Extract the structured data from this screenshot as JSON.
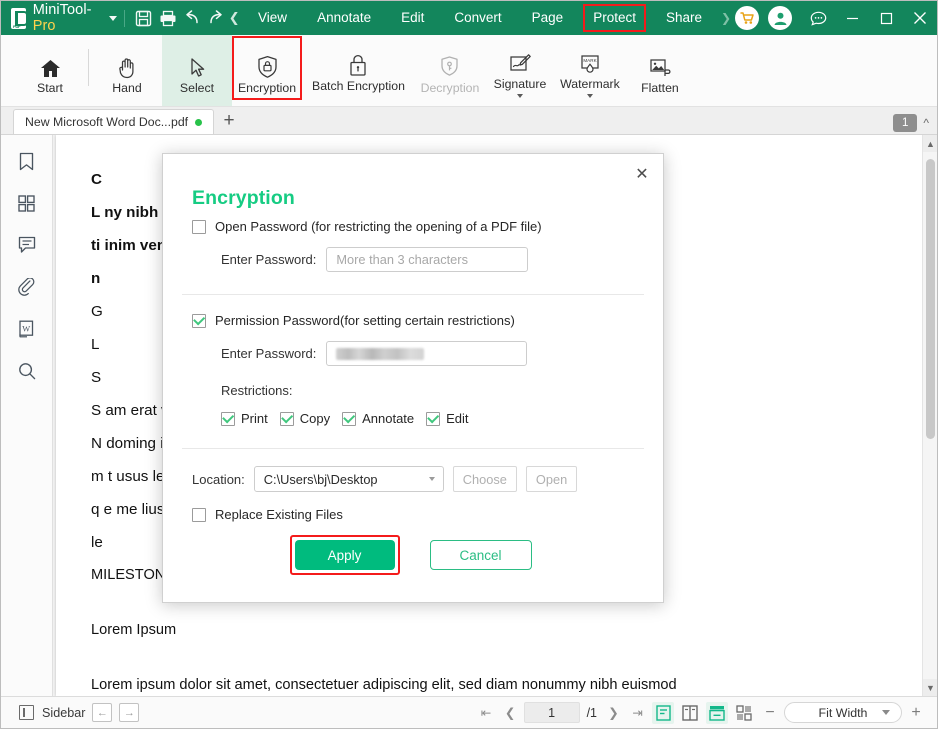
{
  "titlebar": {
    "brand_name_main": "MiniTool-",
    "brand_name_accent": "Pro",
    "logo_icon": "pdf-logo-icon",
    "save_icon": "save-icon",
    "print_icon": "print-icon",
    "undo_icon": "undo-icon",
    "redo_icon": "redo-icon",
    "collapse_icon": "chevron-left-icon",
    "menu": [
      {
        "label": "View",
        "active": false,
        "highlighted": false
      },
      {
        "label": "Annotate",
        "active": false,
        "highlighted": false
      },
      {
        "label": "Edit",
        "active": false,
        "highlighted": false
      },
      {
        "label": "Convert",
        "active": false,
        "highlighted": false
      },
      {
        "label": "Page",
        "active": false,
        "highlighted": false
      },
      {
        "label": "Protect",
        "active": true,
        "highlighted": true
      },
      {
        "label": "Share",
        "active": false,
        "highlighted": false
      }
    ],
    "menu_more_icon": "chevron-right-icon",
    "cart_icon": "shopping-cart-icon",
    "account_icon": "user-account-icon",
    "feedback_icon": "chat-bubble-icon",
    "minimize_icon": "minimize-icon",
    "maximize_icon": "maximize-icon",
    "close_icon": "close-icon",
    "accent_color": "#13865c",
    "highlight_color": "#f41b1b"
  },
  "ribbon": {
    "items": [
      {
        "label": "Start",
        "icon": "home-icon",
        "state": "normal",
        "caret": false,
        "highlighted": false
      },
      {
        "label": "Hand",
        "icon": "hand-icon",
        "state": "normal",
        "caret": false,
        "highlighted": false
      },
      {
        "label": "Select",
        "icon": "cursor-arrow-icon",
        "state": "selected",
        "caret": false,
        "highlighted": false
      },
      {
        "label": "Encryption",
        "icon": "shield-lock-icon",
        "state": "normal",
        "caret": false,
        "highlighted": true
      },
      {
        "label": "Batch Encryption",
        "icon": "padlock-icon",
        "state": "normal",
        "caret": false,
        "highlighted": false
      },
      {
        "label": "Decryption",
        "icon": "shield-key-icon",
        "state": "disabled",
        "caret": false,
        "highlighted": false
      },
      {
        "label": "Signature",
        "icon": "signature-pen-icon",
        "state": "normal",
        "caret": true,
        "highlighted": false
      },
      {
        "label": "Watermark",
        "icon": "watermark-icon",
        "state": "normal",
        "caret": true,
        "highlighted": false
      },
      {
        "label": "Flatten",
        "icon": "flatten-image-icon",
        "state": "normal",
        "caret": false,
        "highlighted": false
      }
    ]
  },
  "tabstrip": {
    "document_tab_label": "New Microsoft Word Doc...pdf",
    "modified_dot": "unsaved-indicator",
    "new_tab_icon": "plus-icon",
    "page_badge": "1",
    "scroll_up_icon": "chevron-up-icon"
  },
  "sidebar": {
    "items": [
      {
        "icon": "bookmark-icon",
        "name": "bookmarks"
      },
      {
        "icon": "thumbnails-icon",
        "name": "thumbnails"
      },
      {
        "icon": "comment-icon",
        "name": "comments"
      },
      {
        "icon": "attachment-icon",
        "name": "attachments"
      },
      {
        "icon": "word-doc-icon",
        "name": "word-export"
      },
      {
        "icon": "search-icon",
        "name": "search"
      }
    ]
  },
  "document": {
    "lines": [
      {
        "text": "C",
        "bold": true,
        "kind": "heading"
      },
      {
        "text": "L                                                                                                 ny nibh euismod",
        "bold": true,
        "kind": "body"
      },
      {
        "text": "ti                                                                                                 inim veniam, quis",
        "bold": true,
        "kind": "body"
      },
      {
        "text": "n",
        "bold": true,
        "kind": "body"
      },
      {
        "text": "G",
        "bold": false,
        "kind": "body"
      },
      {
        "text": "L",
        "bold": false,
        "kind": "body"
      },
      {
        "text": "S",
        "bold": false,
        "kind": "body"
      },
      {
        "text": "S                                                                                                 am erat volutpat.",
        "bold": false,
        "kind": "body"
      },
      {
        "text": "N                                                                                                 doming id quod",
        "bold": false,
        "kind": "body"
      },
      {
        "text": "m                                                                                                 t usus legentis in iis",
        "bold": false,
        "kind": "body"
      },
      {
        "text": "q                                                                                                 e me lius quod ii",
        "bold": false,
        "kind": "body"
      },
      {
        "text": "le",
        "bold": false,
        "kind": "body"
      }
    ],
    "visible_tail": [
      "MILESTONES",
      "Lorem Ipsum",
      "Lorem ipsum dolor sit amet, consectetuer adipiscing elit, sed diam nonummy nibh euismod"
    ]
  },
  "dialog": {
    "title": "Encryption",
    "title_color": "#16cc83",
    "close_icon": "close-icon",
    "open_password": {
      "checkbox_label": "Open Password (for restricting the opening of a PDF file)",
      "checked": false,
      "field_label": "Enter Password:",
      "placeholder": "More than 3 characters",
      "value": ""
    },
    "permission_password": {
      "checkbox_label": "Permission Password(for setting certain restrictions)",
      "checked": true,
      "field_label": "Enter Password:",
      "value": "••••••••",
      "masked": true,
      "restrictions_label": "Restrictions:",
      "restrictions": [
        {
          "label": "Print",
          "checked": true
        },
        {
          "label": "Copy",
          "checked": true
        },
        {
          "label": "Annotate",
          "checked": true
        },
        {
          "label": "Edit",
          "checked": true
        }
      ]
    },
    "location": {
      "label": "Location:",
      "value": "C:\\Users\\bj\\Desktop",
      "choose_label": "Choose",
      "open_label": "Open",
      "choose_disabled": true,
      "open_disabled": true
    },
    "replace_existing": {
      "label": "Replace Existing Files",
      "checked": false
    },
    "apply_label": "Apply",
    "cancel_label": "Cancel",
    "apply_highlighted": true
  },
  "statusbar": {
    "sidebar_toggle_icon": "sidebar-panel-icon",
    "sidebar_label": "Sidebar",
    "prev_panel_icon": "arrow-left-icon",
    "next_panel_icon": "arrow-right-icon",
    "first_page_icon": "first-page-icon",
    "prev_page_icon": "prev-page-icon",
    "current_page": "1",
    "total_pages": "/1",
    "next_page_icon": "next-page-icon",
    "last_page_icon": "last-page-icon",
    "view_modes": [
      {
        "icon": "single-page-view-icon",
        "active": true
      },
      {
        "icon": "two-page-view-icon",
        "active": false
      },
      {
        "icon": "continuous-scroll-icon",
        "active": true
      },
      {
        "icon": "grid-page-view-icon",
        "active": false
      }
    ],
    "zoom_out_icon": "minus-icon",
    "zoom_level": "Fit Width",
    "zoom_dropdown_icon": "chevron-down-icon",
    "zoom_in_icon": "plus-icon"
  }
}
